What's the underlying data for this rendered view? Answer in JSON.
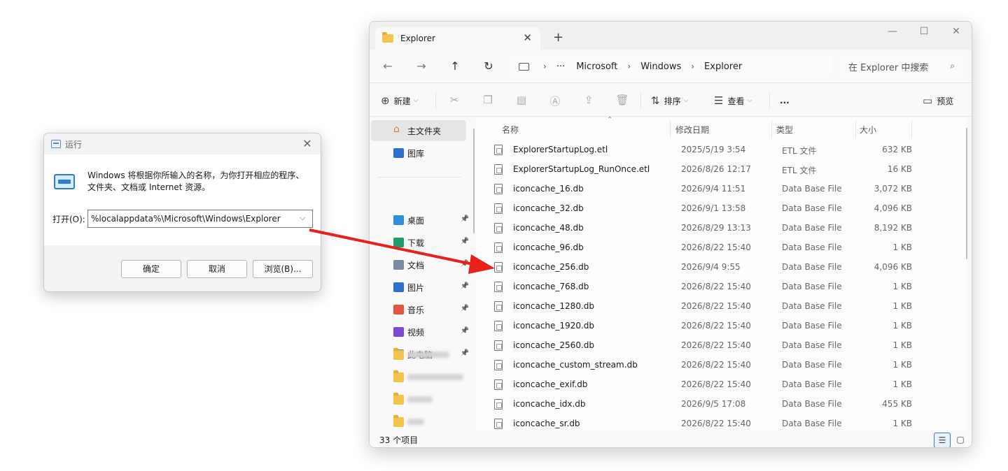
{
  "run_dialog": {
    "title": "运行",
    "description": "Windows 将根据你所输入的名称，为你打开相应的程序、文件夹、文档或 Internet 资源。",
    "open_label": "打开(O):",
    "open_value": "%localappdata%\\Microsoft\\Windows\\Explorer",
    "ok_label": "确定",
    "cancel_label": "取消",
    "browse_label": "浏览(B)..."
  },
  "explorer": {
    "tab_title": "Explorer",
    "breadcrumb": [
      "Microsoft",
      "Windows",
      "Explorer"
    ],
    "search_placeholder": "在 Explorer 中搜索",
    "toolbar": {
      "new_label": "新建",
      "sort_label": "排序",
      "view_label": "查看",
      "more_label": "...",
      "preview_label": "预览"
    },
    "sidebar": {
      "home": "主文件夹",
      "gallery": "图库",
      "items": [
        {
          "label": "桌面",
          "icon": "desktop-icon",
          "color": "#2f8fdc"
        },
        {
          "label": "下载",
          "icon": "download-icon",
          "color": "#1f9e6b"
        },
        {
          "label": "文档",
          "icon": "document-icon",
          "color": "#7a8aa0"
        },
        {
          "label": "图片",
          "icon": "pictures-icon",
          "color": "#2f6fd0"
        },
        {
          "label": "音乐",
          "icon": "music-icon",
          "color": "#e2553f"
        },
        {
          "label": "视频",
          "icon": "video-icon",
          "color": "#7a4ad6"
        },
        {
          "label": "此电脑",
          "icon": "pc-icon",
          "color": "#2aa3d8"
        }
      ]
    },
    "columns": {
      "name": "名称",
      "date": "修改日期",
      "type": "类型",
      "size": "大小"
    },
    "files": [
      {
        "name": "ExplorerStartupLog.etl",
        "date": "2025/5/19 3:54",
        "type": "ETL 文件",
        "size": "632 KB"
      },
      {
        "name": "ExplorerStartupLog_RunOnce.etl",
        "date": "2026/8/26 12:17",
        "type": "ETL 文件",
        "size": "16 KB"
      },
      {
        "name": "iconcache_16.db",
        "date": "2026/9/4 11:51",
        "type": "Data Base File",
        "size": "3,072 KB"
      },
      {
        "name": "iconcache_32.db",
        "date": "2026/9/1 13:58",
        "type": "Data Base File",
        "size": "4,096 KB"
      },
      {
        "name": "iconcache_48.db",
        "date": "2026/8/29 13:13",
        "type": "Data Base File",
        "size": "8,192 KB"
      },
      {
        "name": "iconcache_96.db",
        "date": "2026/8/22 15:40",
        "type": "Data Base File",
        "size": "1 KB"
      },
      {
        "name": "iconcache_256.db",
        "date": "2026/9/4 9:55",
        "type": "Data Base File",
        "size": "4,096 KB"
      },
      {
        "name": "iconcache_768.db",
        "date": "2026/8/22 15:40",
        "type": "Data Base File",
        "size": "1 KB"
      },
      {
        "name": "iconcache_1280.db",
        "date": "2026/8/22 15:40",
        "type": "Data Base File",
        "size": "1 KB"
      },
      {
        "name": "iconcache_1920.db",
        "date": "2026/8/22 15:40",
        "type": "Data Base File",
        "size": "1 KB"
      },
      {
        "name": "iconcache_2560.db",
        "date": "2026/8/22 15:40",
        "type": "Data Base File",
        "size": "1 KB"
      },
      {
        "name": "iconcache_custom_stream.db",
        "date": "2026/8/22 15:40",
        "type": "Data Base File",
        "size": "1 KB"
      },
      {
        "name": "iconcache_exif.db",
        "date": "2026/8/22 15:40",
        "type": "Data Base File",
        "size": "1 KB"
      },
      {
        "name": "iconcache_idx.db",
        "date": "2026/9/5 17:08",
        "type": "Data Base File",
        "size": "455 KB"
      },
      {
        "name": "iconcache_sr.db",
        "date": "2026/8/22 15:40",
        "type": "Data Base File",
        "size": "1 KB"
      }
    ],
    "status": "33 个项目",
    "arrow_color": "#e8201c"
  }
}
